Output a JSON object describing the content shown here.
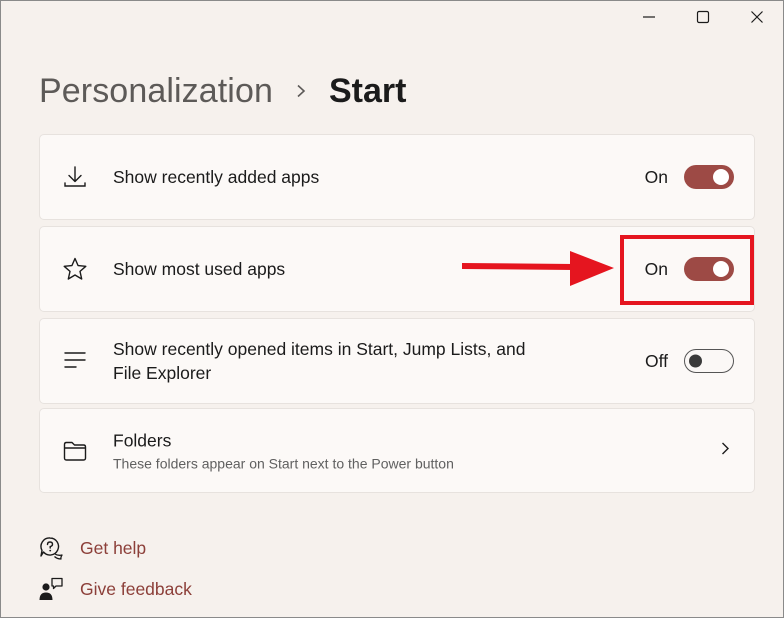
{
  "window": {
    "controls": [
      {
        "name": "minimize-button",
        "icon": "minimize-icon"
      },
      {
        "name": "maximize-button",
        "icon": "maximize-icon"
      },
      {
        "name": "close-button",
        "icon": "close-icon"
      }
    ]
  },
  "breadcrumb": {
    "parent": "Personalization",
    "separator_icon": "chevron-right-icon",
    "current": "Start"
  },
  "settings": [
    {
      "label": "Show recently added apps",
      "icon": "download-icon",
      "state": "On",
      "checked": true
    },
    {
      "label": "Show most used apps",
      "icon": "star-icon",
      "state": "On",
      "checked": true
    },
    {
      "label": "Show recently opened items in Start, Jump Lists, and",
      "label_line2": "File Explorer",
      "icon": "list-icon",
      "state": "Off",
      "checked": false
    },
    {
      "label": "Folders",
      "subtitle": "These folders appear on Start next to the Power button",
      "icon": "folder-icon",
      "action_icon": "chevron-right-icon"
    }
  ],
  "links": [
    {
      "label": "Get help",
      "icon": "help-chat-icon"
    },
    {
      "label": "Give feedback",
      "icon": "feedback-icon"
    }
  ],
  "colors": {
    "background": "#f6f1ed",
    "card": "#fcf9f7",
    "accent": "#9d4a45",
    "link": "#8c3f39",
    "annotation": "#e5151f"
  },
  "annotation": {
    "type": "arrow-and-box",
    "target": "Show most used apps toggle"
  }
}
